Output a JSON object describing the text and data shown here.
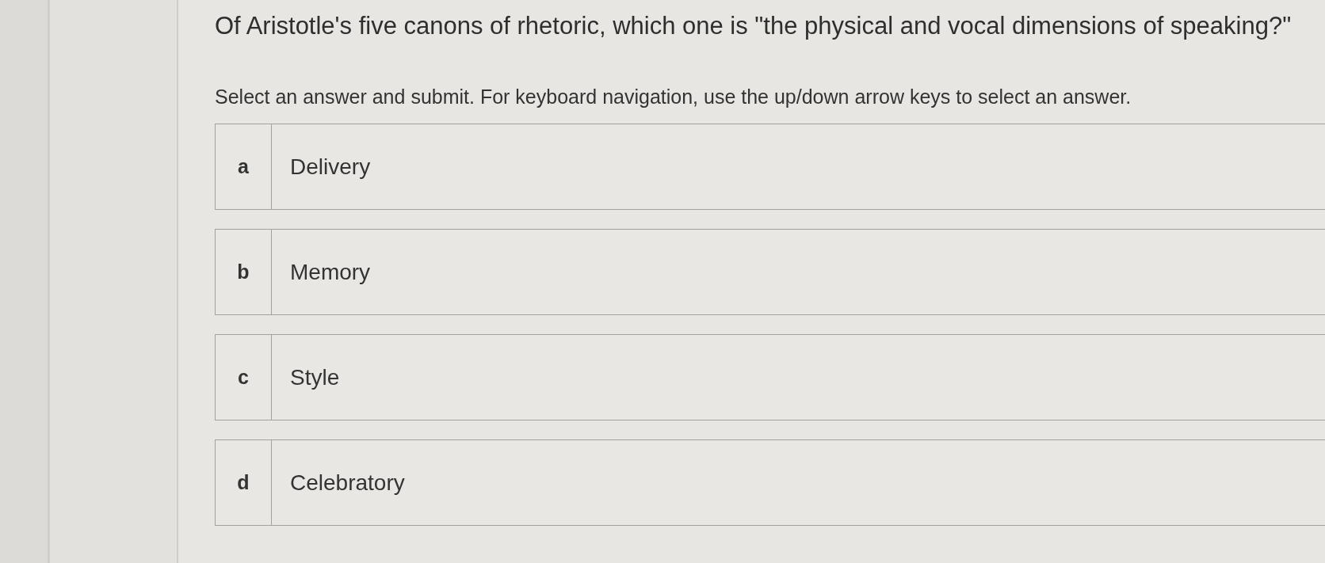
{
  "question": "Of Aristotle's five canons of rhetoric, which one is \"the physical and vocal dimensions of speaking?\"",
  "instructions": "Select an answer and submit. For keyboard navigation, use the up/down arrow keys to select an answer.",
  "options": [
    {
      "letter": "a",
      "text": "Delivery",
      "selected": false
    },
    {
      "letter": "b",
      "text": "Memory",
      "selected": false
    },
    {
      "letter": "c",
      "text": "Style",
      "selected": false
    },
    {
      "letter": "d",
      "text": "Celebratory",
      "selected": false
    }
  ]
}
